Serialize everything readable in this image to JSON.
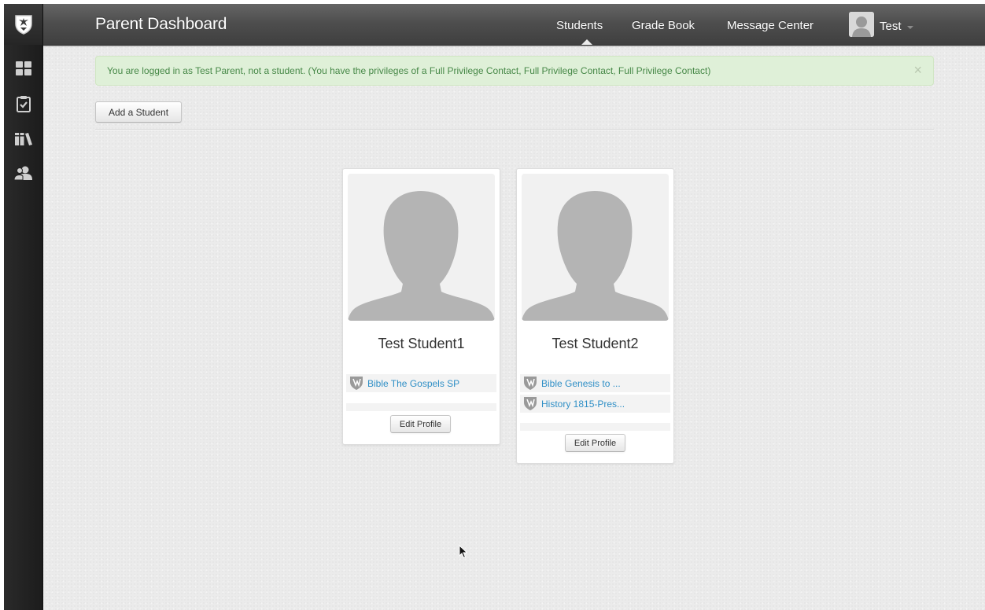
{
  "navbar": {
    "brand": "Parent Dashboard",
    "links": [
      "Students",
      "Grade Book",
      "Message Center"
    ],
    "user_name": "Test"
  },
  "sidebar": {
    "icons": [
      "shield-logo-icon",
      "dashboard-grid-icon",
      "checklist-icon",
      "library-books-icon",
      "users-icon"
    ]
  },
  "alert": {
    "text": "You are logged in as Test Parent, not a student. (You have the privileges of a Full Privilege Contact, Full Privilege Contact, Full Privilege Contact)",
    "close": "×"
  },
  "actions": {
    "add_student": "Add a Student"
  },
  "students": [
    {
      "name": "Test Student1",
      "courses": [
        "Bible The Gospels SP"
      ],
      "edit_label": "Edit Profile"
    },
    {
      "name": "Test Student2",
      "courses": [
        "Bible Genesis to ...",
        "History 1815-Pres..."
      ],
      "edit_label": "Edit Profile"
    }
  ],
  "colors": {
    "link": "#2f8fc6",
    "alert_bg": "#dff0d8",
    "alert_text": "#468847",
    "navbar": "#4e4e4e",
    "sidebar": "#222222"
  }
}
